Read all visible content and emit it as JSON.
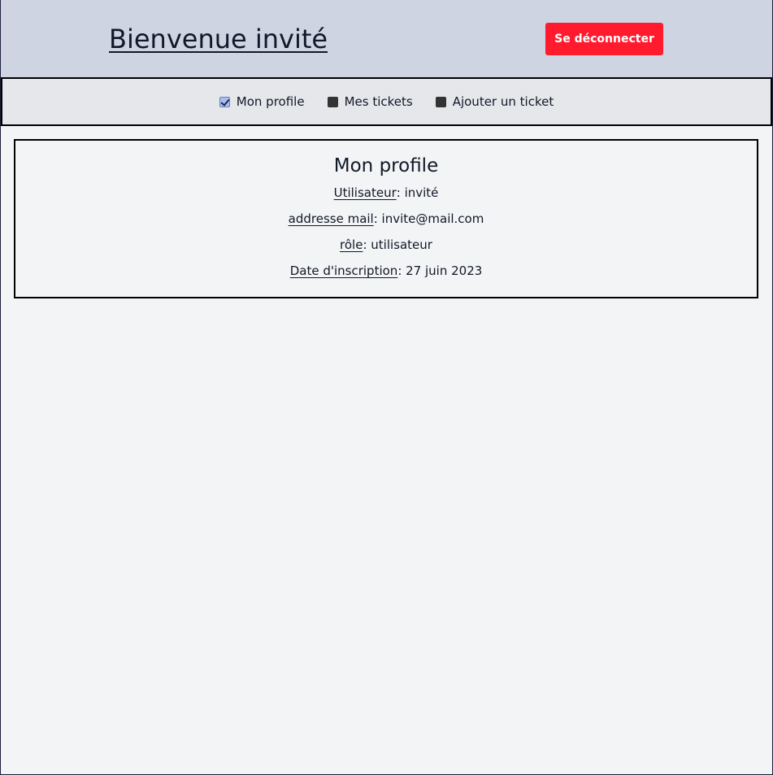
{
  "header": {
    "title": "Bienvenue invité",
    "logout_label": "Se déconnecter",
    "logout_color": "#ff1a2e"
  },
  "nav": {
    "items": [
      {
        "label": "Mon profile",
        "checked": true
      },
      {
        "label": "Mes tickets",
        "checked": false
      },
      {
        "label": "Ajouter un ticket",
        "checked": false
      }
    ]
  },
  "profile": {
    "title": "Mon profile",
    "fields": [
      {
        "label": "Utilisateur ",
        "value": " : invité"
      },
      {
        "label": "addresse mail ",
        "value": " : invite@mail.com"
      },
      {
        "label": "rôle ",
        "value": " : utilisateur"
      },
      {
        "label": "Date d'inscription ",
        "value": " : 27 juin 2023"
      }
    ]
  }
}
